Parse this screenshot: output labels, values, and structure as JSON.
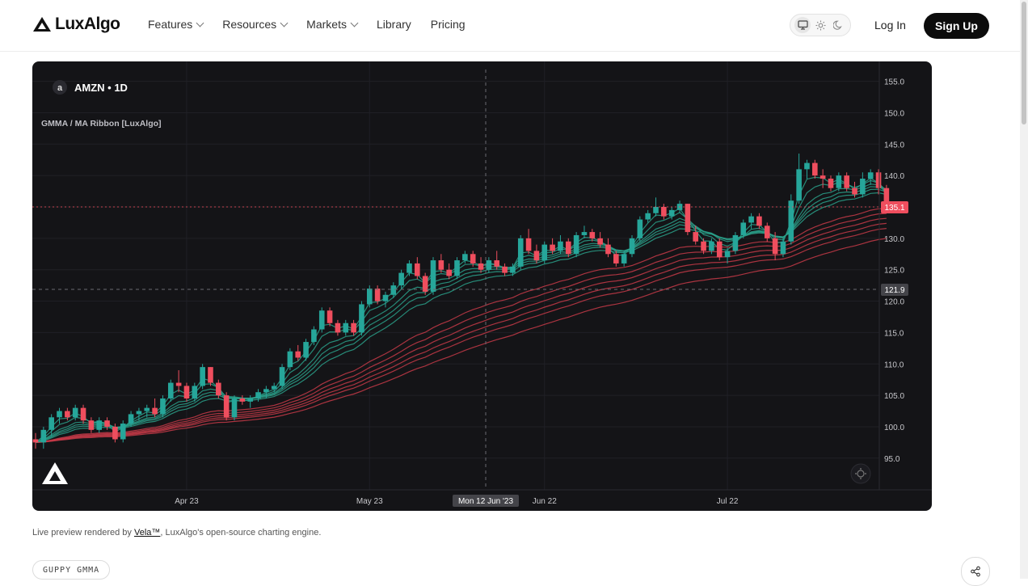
{
  "brand": {
    "name": "LuxAlgo"
  },
  "nav": {
    "items": [
      {
        "label": "Features",
        "dropdown": true
      },
      {
        "label": "Resources",
        "dropdown": true
      },
      {
        "label": "Markets",
        "dropdown": true
      },
      {
        "label": "Library",
        "dropdown": false
      },
      {
        "label": "Pricing",
        "dropdown": false
      }
    ]
  },
  "header": {
    "theme_options": [
      "monitor-icon",
      "sun-icon",
      "moon-icon"
    ],
    "active_theme": "monitor-icon",
    "login_label": "Log In",
    "signup_label": "Sign Up"
  },
  "chart": {
    "symbol": "AMZN",
    "interval": "1D",
    "symbol_badge": "a",
    "indicator_name": "GMMA / MA Ribbon [LuxAlgo]",
    "price_marker": "135.1",
    "crosshair_price": "121.9",
    "crosshair_date": "Mon 12 Jun '23",
    "colors": {
      "up": "#26a69a",
      "down": "#ef4e5e",
      "background": "#141417",
      "price_marker": "#ef4e5e",
      "short_ribbon": "#2aa089",
      "long_ribbon": "#c53a48"
    }
  },
  "chart_data": {
    "type": "candlestick",
    "y_ticks": [
      "155.0",
      "150.0",
      "145.0",
      "140.0",
      "135.0",
      "130.0",
      "125.0",
      "120.0",
      "115.0",
      "110.0",
      "105.0",
      "100.0",
      "95.0"
    ],
    "ylim": [
      92.5,
      157
    ],
    "x_ticks": [
      "Apr 23",
      "May 23",
      "Jun 22",
      "Jul 22"
    ],
    "ohlc": [
      [
        98,
        99,
        96.5,
        97.5
      ],
      [
        97.5,
        100,
        96.5,
        99.5
      ],
      [
        99.5,
        102,
        98.5,
        101.5
      ],
      [
        101.5,
        103,
        100.5,
        102.5
      ],
      [
        102.5,
        103,
        101,
        101.5
      ],
      [
        101.5,
        103.5,
        101,
        103
      ],
      [
        103,
        103.5,
        100.5,
        101
      ],
      [
        101,
        101.5,
        99,
        99.5
      ],
      [
        99.5,
        101.5,
        99,
        101
      ],
      [
        101,
        101.5,
        99.5,
        100
      ],
      [
        100,
        100.5,
        97.5,
        98
      ],
      [
        98,
        101,
        97.5,
        100.5
      ],
      [
        100.5,
        102.5,
        100,
        102
      ],
      [
        102,
        103,
        101,
        102.5
      ],
      [
        102.5,
        103.5,
        101.5,
        103
      ],
      [
        103,
        104.5,
        101.5,
        102
      ],
      [
        102,
        105,
        101.5,
        104.5
      ],
      [
        104.5,
        107.5,
        104,
        107
      ],
      [
        107,
        109,
        105.5,
        106.5
      ],
      [
        106.5,
        107,
        104,
        104.5
      ],
      [
        104.5,
        107,
        104,
        106.5
      ],
      [
        106.5,
        110,
        106,
        109.5
      ],
      [
        109.5,
        109.5,
        106.5,
        107
      ],
      [
        107,
        107.5,
        104.5,
        105
      ],
      [
        105,
        105.5,
        101,
        101.5
      ],
      [
        101.5,
        105,
        101,
        104.5
      ],
      [
        104.5,
        105,
        103.5,
        104
      ],
      [
        104,
        105,
        103,
        104.5
      ],
      [
        104.5,
        106,
        104,
        105.5
      ],
      [
        105.5,
        106.5,
        104.5,
        106
      ],
      [
        106,
        107,
        105.5,
        106.5
      ],
      [
        106.5,
        110,
        106,
        109.5
      ],
      [
        109.5,
        112.5,
        109,
        112
      ],
      [
        112,
        113,
        110.5,
        111
      ],
      [
        111,
        114,
        110.5,
        113.5
      ],
      [
        113.5,
        116,
        113,
        115.5
      ],
      [
        115.5,
        119,
        115,
        118.5
      ],
      [
        118.5,
        119,
        116,
        116.5
      ],
      [
        116.5,
        117,
        114.5,
        115
      ],
      [
        115,
        117,
        114.5,
        116.5
      ],
      [
        116.5,
        117,
        114.5,
        115
      ],
      [
        115,
        120,
        114.5,
        119.5
      ],
      [
        119.5,
        122.5,
        119,
        122
      ],
      [
        122,
        122.5,
        119.5,
        120
      ],
      [
        120,
        121.5,
        119,
        121
      ],
      [
        121,
        123,
        120.5,
        122.5
      ],
      [
        122.5,
        125,
        122,
        124.5
      ],
      [
        124.5,
        126.5,
        124,
        126
      ],
      [
        126,
        127,
        123.5,
        124
      ],
      [
        124,
        124.5,
        121,
        121.5
      ],
      [
        121.5,
        127,
        121,
        126.5
      ],
      [
        126.5,
        127.5,
        124.5,
        125
      ],
      [
        125,
        126,
        123.5,
        124
      ],
      [
        124,
        127,
        123.5,
        126.5
      ],
      [
        126.5,
        128,
        126,
        127.5
      ],
      [
        127.5,
        128,
        125.5,
        126
      ],
      [
        126,
        127,
        124.5,
        125
      ],
      [
        125,
        127,
        124.5,
        126.5
      ],
      [
        126.5,
        128,
        125,
        125.5
      ],
      [
        125.5,
        126,
        124,
        124.5
      ],
      [
        124.5,
        126,
        124,
        125.5
      ],
      [
        125.5,
        130.5,
        125,
        130
      ],
      [
        130,
        131.5,
        127.5,
        128
      ],
      [
        128,
        129,
        126,
        126.5
      ],
      [
        126.5,
        129.5,
        126,
        129
      ],
      [
        129,
        130,
        127.5,
        128
      ],
      [
        128,
        130.5,
        127.5,
        129.5
      ],
      [
        129.5,
        130,
        127,
        127.5
      ],
      [
        127.5,
        131,
        127,
        130.5
      ],
      [
        130.5,
        132,
        130,
        131
      ],
      [
        131,
        131.5,
        129.5,
        130
      ],
      [
        130,
        131,
        128.5,
        129
      ],
      [
        129,
        130,
        127,
        127.5
      ],
      [
        127.5,
        128,
        125.5,
        126
      ],
      [
        126,
        128,
        125.5,
        127.5
      ],
      [
        127.5,
        130.5,
        127,
        130
      ],
      [
        130,
        133.5,
        129.5,
        133
      ],
      [
        133,
        134.5,
        132.5,
        134
      ],
      [
        134,
        136.5,
        133.5,
        135
      ],
      [
        135,
        135.5,
        133,
        133.5
      ],
      [
        133.5,
        135,
        133,
        134.5
      ],
      [
        134.5,
        136,
        134,
        135.5
      ],
      [
        135.5,
        135.5,
        130.5,
        131
      ],
      [
        131,
        132,
        129,
        129.5
      ],
      [
        129.5,
        130,
        127.5,
        128
      ],
      [
        128,
        130,
        127.5,
        129.5
      ],
      [
        129.5,
        130,
        126.5,
        127
      ],
      [
        127,
        128.5,
        126,
        128
      ],
      [
        128,
        131,
        127.5,
        130.5
      ],
      [
        130.5,
        133,
        130,
        132.5
      ],
      [
        132.5,
        134,
        131.5,
        133.5
      ],
      [
        133.5,
        134,
        131.5,
        132
      ],
      [
        132,
        132.5,
        129.5,
        130
      ],
      [
        130,
        131,
        126.5,
        127.5
      ],
      [
        127.5,
        130,
        127,
        129.5
      ],
      [
        129.5,
        137,
        129,
        136
      ],
      [
        136,
        143.5,
        135.5,
        141
      ],
      [
        141,
        142.5,
        139.5,
        142
      ],
      [
        142,
        142.5,
        139.5,
        140
      ],
      [
        140,
        141,
        138,
        139.5
      ],
      [
        139.5,
        140,
        137.5,
        138
      ],
      [
        138,
        140.5,
        137.5,
        140
      ],
      [
        140,
        140.5,
        137.5,
        138
      ],
      [
        138,
        139,
        136.5,
        137
      ],
      [
        137,
        140.5,
        136.5,
        139.5
      ],
      [
        139.5,
        141,
        138.5,
        140.5
      ],
      [
        140.5,
        141,
        137,
        138
      ],
      [
        138,
        138.5,
        134.5,
        135.1
      ]
    ]
  },
  "footer": {
    "caption_prefix": "Live preview rendered by ",
    "caption_link": "Vela™",
    "caption_suffix": ", LuxAlgo's open-source charting engine.",
    "tag_label": "GUPPY GMMA"
  }
}
